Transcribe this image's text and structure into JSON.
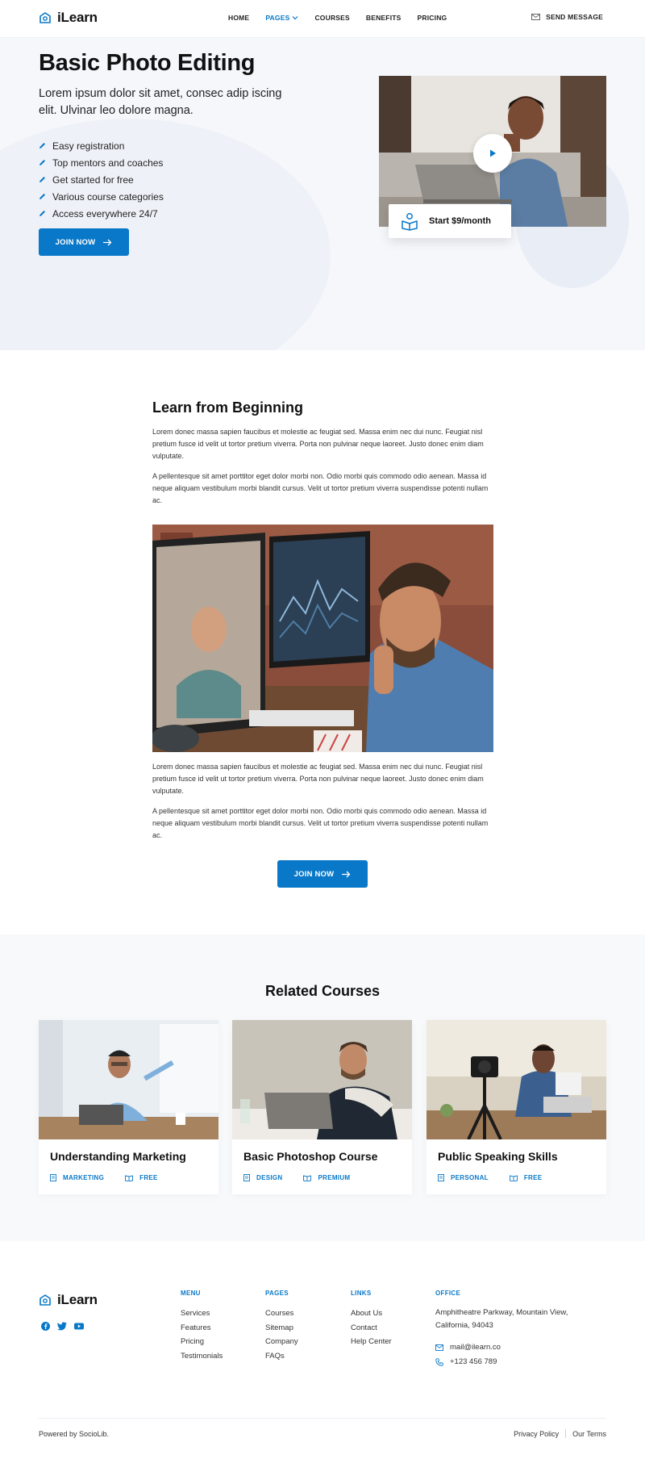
{
  "header": {
    "brand": "iLearn",
    "nav": [
      "HOME",
      "PAGES",
      "COURSES",
      "BENEFITS",
      "PRICING"
    ],
    "send_message": "SEND MESSAGE"
  },
  "hero": {
    "title": "Basic Photo Editing",
    "subtitle": "Lorem ipsum dolor sit amet, consec adip iscing elit. Ulvinar leo dolore magna.",
    "features": [
      "Easy registration",
      "Top mentors and coaches",
      "Get started for free",
      "Various course categories",
      "Access everywhere 24/7"
    ],
    "button": "JOIN NOW",
    "price_label": "Start $9/month"
  },
  "learn": {
    "title": "Learn from Beginning",
    "paragraphs": [
      "Lorem donec massa sapien faucibus et molestie ac feugiat sed. Massa enim nec dui nunc. Feugiat nisl pretium fusce id velit ut tortor pretium viverra. Porta non pulvinar neque laoreet. Justo donec enim diam vulputate.",
      "A pellentesque sit amet porttitor eget dolor morbi non. Odio morbi quis commodo odio aenean. Massa id neque aliquam vestibulum morbi blandit cursus. Velit ut tortor pretium viverra suspendisse potenti nullam ac.",
      "Lorem donec massa sapien faucibus et molestie ac feugiat sed. Massa enim nec dui nunc. Feugiat nisl pretium fusce id velit ut tortor pretium viverra. Porta non pulvinar neque laoreet. Justo donec enim diam vulputate.",
      "A pellentesque sit amet porttitor eget dolor morbi non. Odio morbi quis commodo odio aenean. Massa id neque aliquam vestibulum morbi blandit cursus. Velit ut tortor pretium viverra suspendisse potenti nullam ac."
    ],
    "button": "JOIN NOW"
  },
  "related": {
    "title": "Related Courses",
    "courses": [
      {
        "title": "Understanding Marketing",
        "category": "MARKETING",
        "price": "FREE"
      },
      {
        "title": "Basic Photoshop Course",
        "category": "DESIGN",
        "price": "PREMIUM"
      },
      {
        "title": "Public Speaking Skills",
        "category": "PERSONAL",
        "price": "FREE"
      }
    ]
  },
  "footer": {
    "brand": "iLearn",
    "menu": {
      "heading": "MENU",
      "links": [
        "Services",
        "Features",
        "Pricing",
        "Testimonials"
      ]
    },
    "pages": {
      "heading": "PAGES",
      "links": [
        "Courses",
        "Sitemap",
        "Company",
        "FAQs"
      ]
    },
    "links": {
      "heading": "LINKS",
      "links": [
        "About Us",
        "Contact",
        "Help Center"
      ]
    },
    "office": {
      "heading": "OFFICE",
      "address": "Amphitheatre Parkway, Mountain View, California, 94043",
      "email": "mail@ilearn.co",
      "phone": "+123 456 789"
    },
    "powered": "Powered by SocioLib.",
    "bottom_links": [
      "Privacy Policy",
      "Our Terms"
    ]
  },
  "colors": {
    "accent": "#0a78c8",
    "hero_bg": "#f5f7fb",
    "related_bg": "#f8f9fb"
  }
}
